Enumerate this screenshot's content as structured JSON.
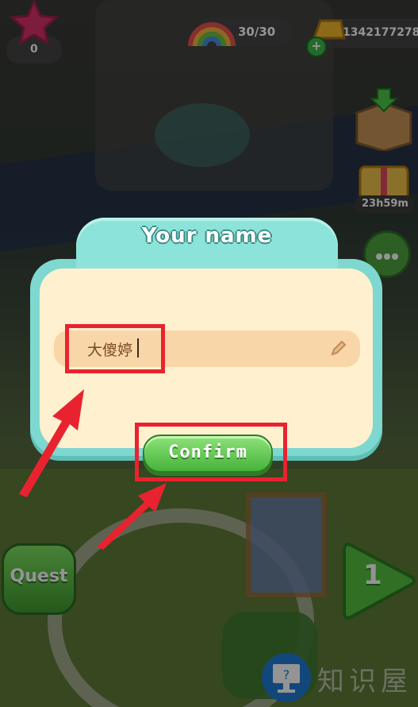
{
  "hud": {
    "stars_count": "0",
    "lives": "30/30",
    "coins": "1342177278",
    "timer": "23h59m",
    "quest_label": "Quest",
    "level_number": "1",
    "watermark": "知识屋"
  },
  "dialog": {
    "title": "Your name",
    "name_value": "大傻婷",
    "confirm_label": "Confirm"
  },
  "colors": {
    "modal_teal": "#7fd8d0",
    "modal_cream": "#fff1cf",
    "field_peach": "#f9d6a8",
    "confirm_green": "#46b33a",
    "highlight_red": "#e8232f"
  }
}
